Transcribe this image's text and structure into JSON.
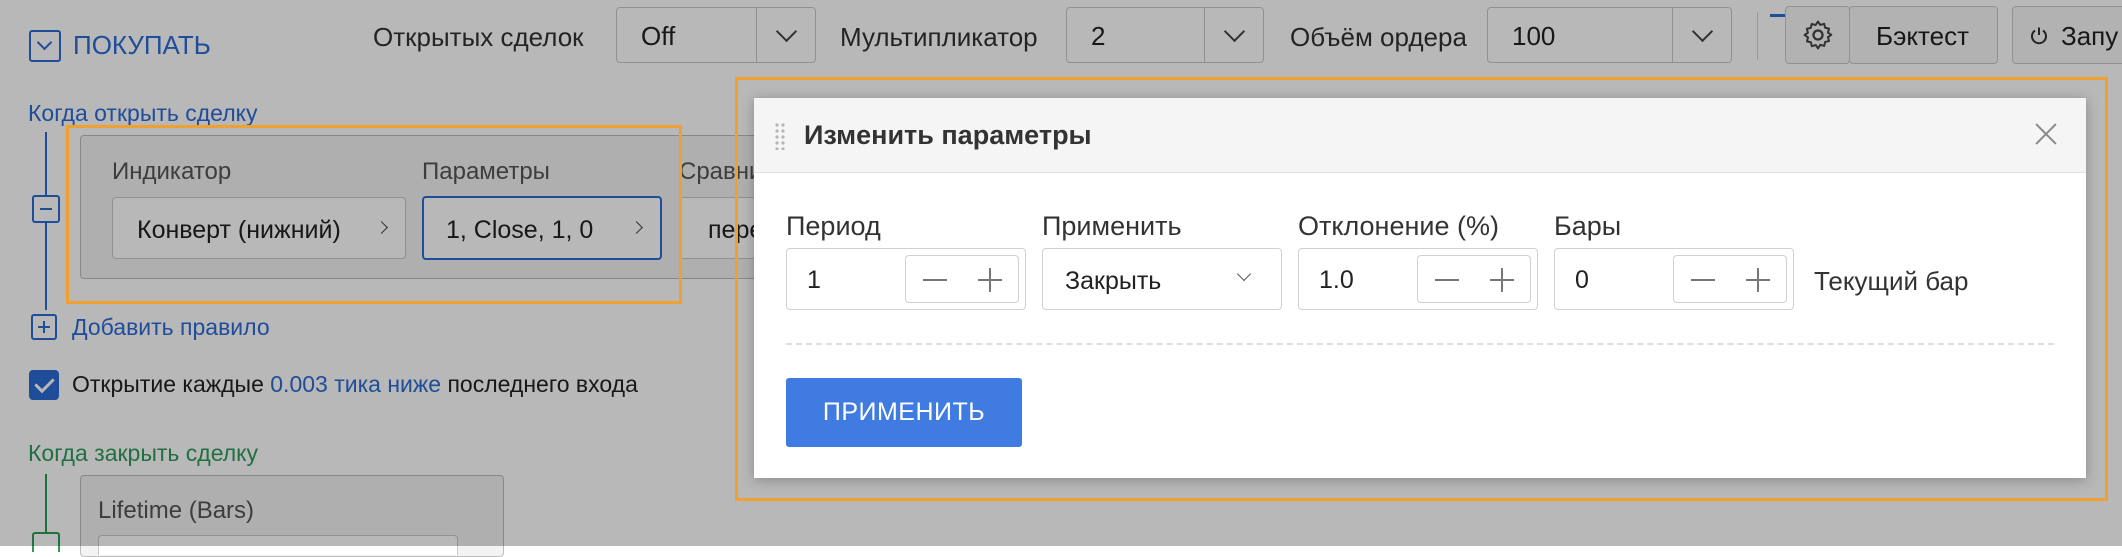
{
  "toolbar": {
    "buy_label": "ПОКУПАТЬ",
    "open_deals_label": "Открытых сделок",
    "open_deals_value": "Off",
    "multiplier_label": "Мультипликатор",
    "multiplier_value": "2",
    "order_volume_label": "Объём ордера",
    "order_volume_value": "100",
    "backtest_label": "Бэктест",
    "launch_label": "Запу"
  },
  "open_rule": {
    "section_title": "Когда открыть сделку",
    "indicator_header": "Индикатор",
    "params_header": "Параметры",
    "compare_header": "Сравни",
    "indicator_value": "Конверт (нижний)",
    "params_value": "1, Close, 1, 0",
    "compare_value": "пере",
    "add_rule": "Добавить правило"
  },
  "open_every": {
    "prefix": "Открытие каждые",
    "value": "0.003 тика ниже",
    "suffix": "последнего входа",
    "checked": true
  },
  "close_rule": {
    "section_title": "Когда закрыть сделку",
    "lifetime_label": "Lifetime (Bars)"
  },
  "dialog": {
    "title": "Изменить параметры",
    "period_label": "Период",
    "period_value": "1",
    "apply_label": "Применить",
    "apply_value": "Закрыть",
    "deviation_label": "Отклонение (%)",
    "deviation_value": "1.0",
    "bars_label": "Бары",
    "bars_value": "0",
    "current_bar": "Текущий бар",
    "submit_label": "ПРИМЕНИТЬ"
  },
  "colors": {
    "accent_blue": "#2b6bd6",
    "section_green": "#2e9b5a",
    "primary_button": "#3f7be0",
    "highlight_orange": "#f0a030"
  },
  "icons": [
    "chevron-down-icon",
    "gear-icon",
    "power-icon",
    "minus-icon",
    "plus-icon",
    "close-icon",
    "drag-handle-icon",
    "check-icon"
  ]
}
